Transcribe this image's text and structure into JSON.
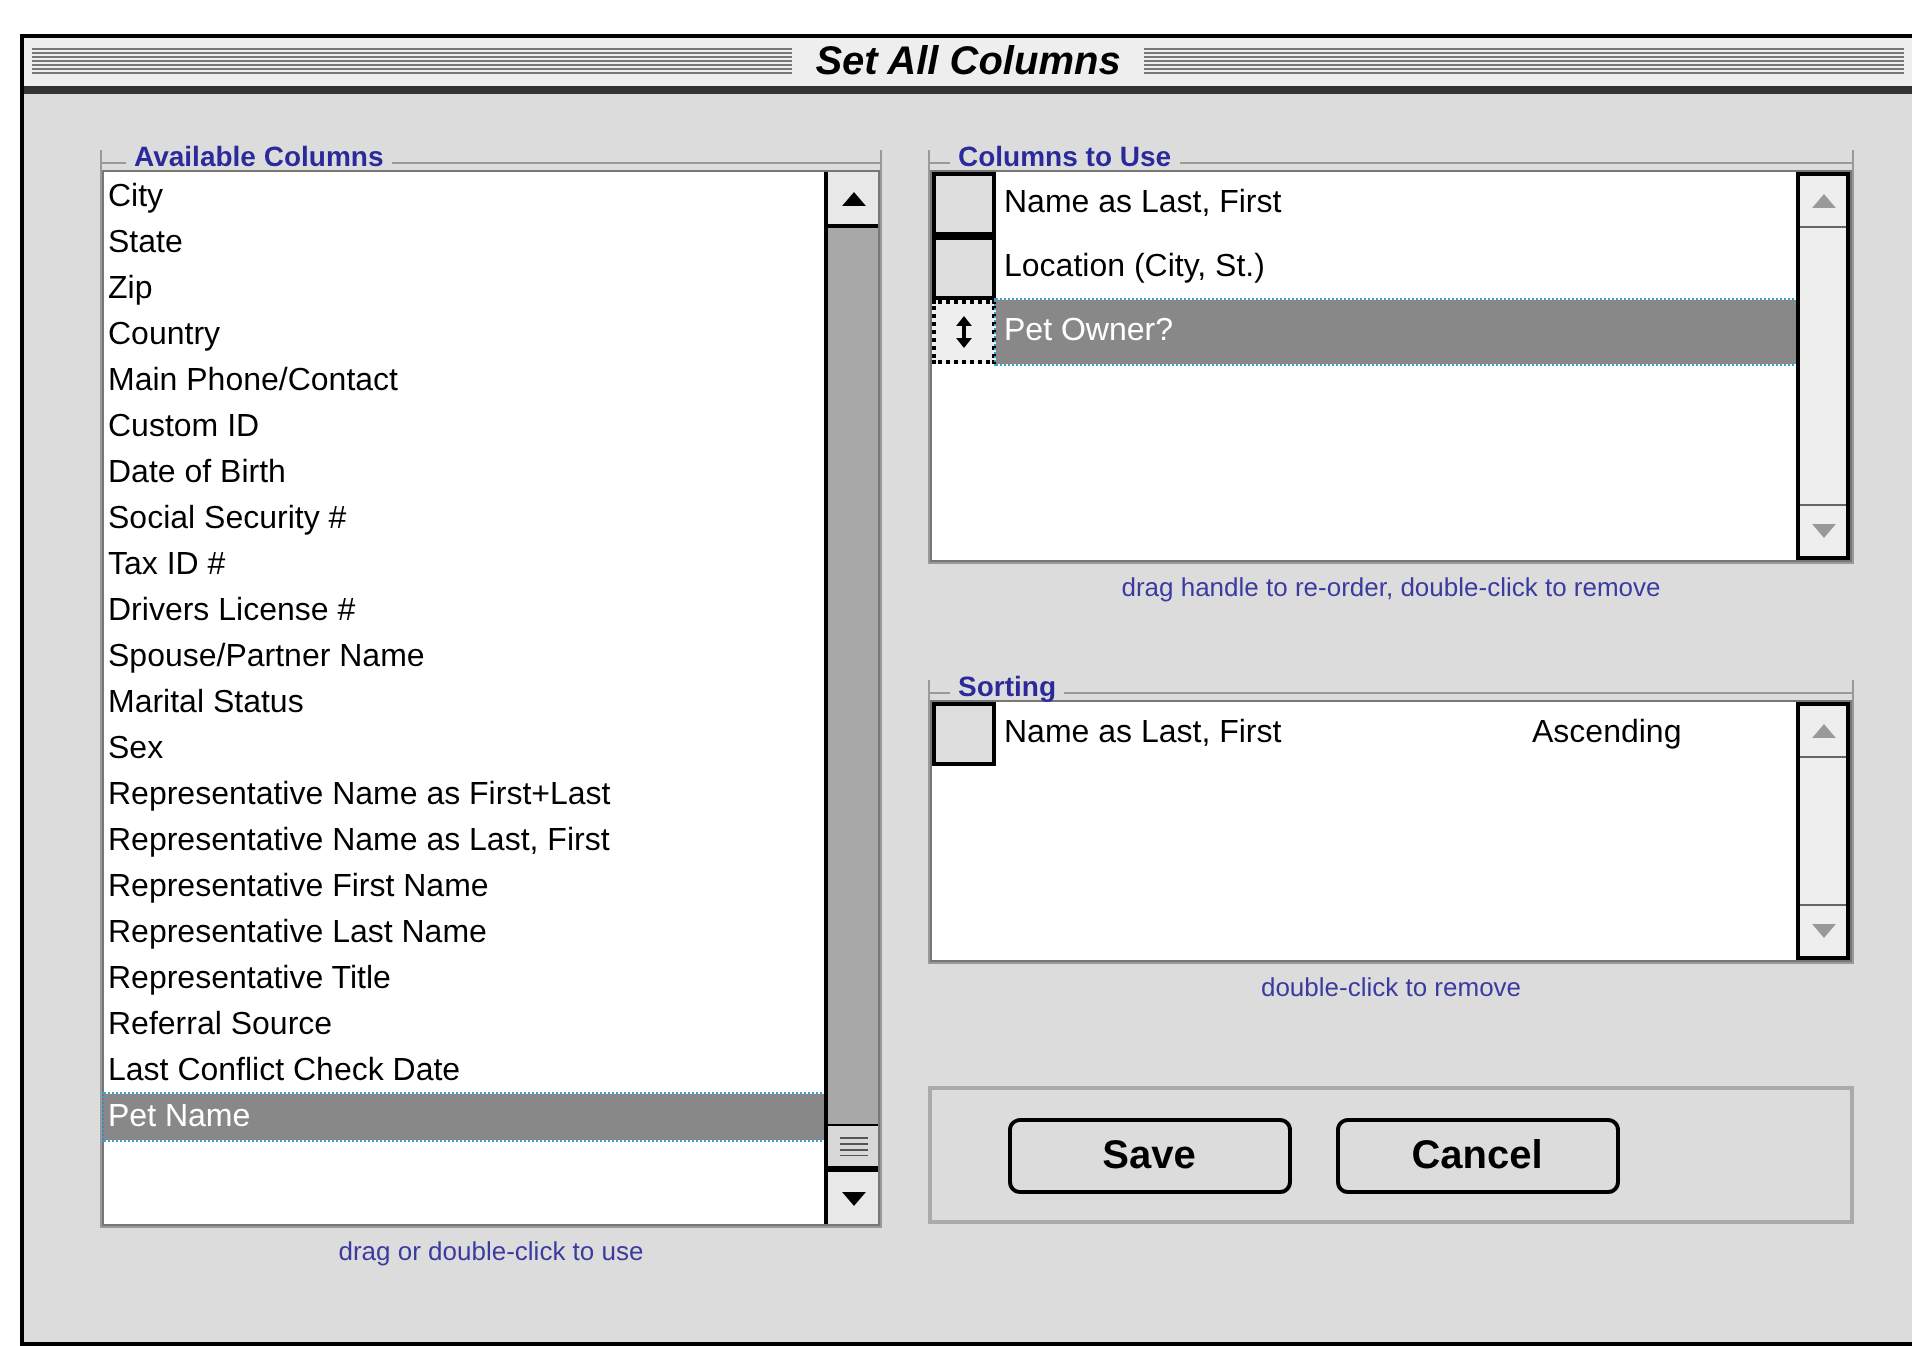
{
  "window": {
    "title": "Set All Columns"
  },
  "available": {
    "label": "Available Columns",
    "items": [
      {
        "text": "City",
        "selected": false
      },
      {
        "text": "State",
        "selected": false
      },
      {
        "text": "Zip",
        "selected": false
      },
      {
        "text": "Country",
        "selected": false
      },
      {
        "text": "Main Phone/Contact",
        "selected": false
      },
      {
        "text": "Custom ID",
        "selected": false
      },
      {
        "text": "Date of Birth",
        "selected": false
      },
      {
        "text": "Social Security #",
        "selected": false
      },
      {
        "text": "Tax ID #",
        "selected": false
      },
      {
        "text": "Drivers License #",
        "selected": false
      },
      {
        "text": "Spouse/Partner Name",
        "selected": false
      },
      {
        "text": "Marital Status",
        "selected": false
      },
      {
        "text": "Sex",
        "selected": false
      },
      {
        "text": "Representative Name as First+Last",
        "selected": false
      },
      {
        "text": "Representative Name as Last, First",
        "selected": false
      },
      {
        "text": "Representative First Name",
        "selected": false
      },
      {
        "text": "Representative Last Name",
        "selected": false
      },
      {
        "text": "Representative Title",
        "selected": false
      },
      {
        "text": "Referral Source",
        "selected": false
      },
      {
        "text": "Last Conflict Check Date",
        "selected": false
      },
      {
        "text": "Pet Name",
        "selected": true
      }
    ],
    "hint": "drag or double-click to use"
  },
  "columns_to_use": {
    "label": "Columns to Use",
    "items": [
      {
        "text": "Name as Last, First",
        "selected": false
      },
      {
        "text": "Location (City, St.)",
        "selected": false
      },
      {
        "text": "Pet Owner?",
        "selected": true
      }
    ],
    "hint": "drag handle to re-order, double-click to remove"
  },
  "sorting": {
    "label": "Sorting",
    "items": [
      {
        "text": "Name as Last, First",
        "order": "Ascending"
      }
    ],
    "hint": "double-click to remove"
  },
  "buttons": [
    "Save",
    "Cancel"
  ]
}
